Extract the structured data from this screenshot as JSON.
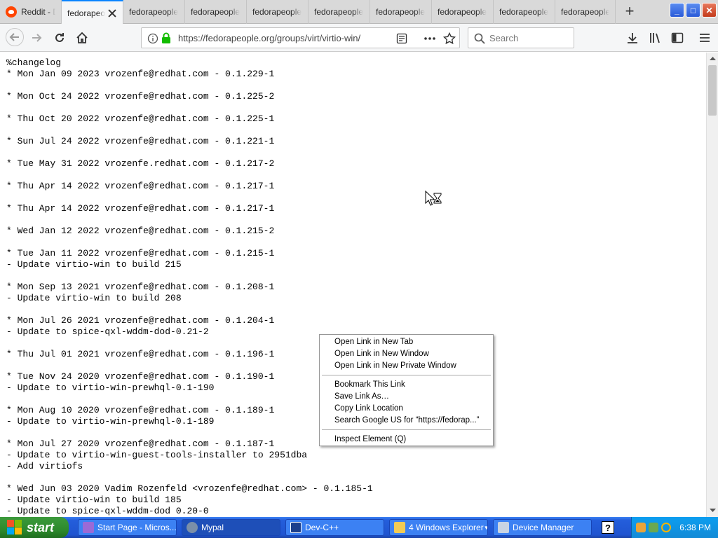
{
  "browser": {
    "tabs": [
      {
        "label": "Reddit - D",
        "active": false
      },
      {
        "label": "fedorapeo",
        "active": true
      },
      {
        "label": "fedorapeople",
        "active": false
      },
      {
        "label": "fedorapeople",
        "active": false
      },
      {
        "label": "fedorapeople",
        "active": false
      },
      {
        "label": "fedorapeople",
        "active": false
      },
      {
        "label": "fedorapeople",
        "active": false
      },
      {
        "label": "fedorapeople",
        "active": false
      },
      {
        "label": "fedorapeople",
        "active": false
      },
      {
        "label": "fedorapeople",
        "active": false
      }
    ],
    "new_tab_symbol": "+",
    "window_controls": {
      "minimize": "_",
      "maximize": "□",
      "close": "✕"
    },
    "url": "https://fedorapeople.org/groups/virt/virtio-win/",
    "search_placeholder": "Search",
    "icons": {
      "back": "arrow-left-icon",
      "forward": "arrow-right-icon",
      "reload": "reload-icon",
      "home": "home-icon",
      "info": "info-icon",
      "lock": "lock-icon",
      "reader": "reader-view-icon",
      "more": "more-icon",
      "bookmark": "star-icon",
      "search": "search-icon",
      "downloads": "download-icon",
      "library": "library-icon",
      "sidebar": "sidebar-icon",
      "menu": "hamburger-icon"
    },
    "accent_color": "#0a84ff",
    "lock_color": "#12bc00"
  },
  "changelog": [
    "%changelog",
    "* Mon Jan 09 2023 vrozenfe@redhat.com - 0.1.229-1",
    "",
    "* Mon Oct 24 2022 vrozenfe@redhat.com - 0.1.225-2",
    "",
    "* Thu Oct 20 2022 vrozenfe@redhat.com - 0.1.225-1",
    "",
    "* Sun Jul 24 2022 vrozenfe@redhat.com - 0.1.221-1",
    "",
    "* Tue May 31 2022 vrozenfe.redhat.com - 0.1.217-2",
    "",
    "* Thu Apr 14 2022 vrozenfe@redhat.com - 0.1.217-1",
    "",
    "* Thu Apr 14 2022 vrozenfe@redhat.com - 0.1.217-1",
    "",
    "* Wed Jan 12 2022 vrozenfe@redhat.com - 0.1.215-2",
    "",
    "* Tue Jan 11 2022 vrozenfe@redhat.com - 0.1.215-1",
    "- Update virtio-win to build 215",
    "",
    "* Mon Sep 13 2021 vrozenfe@redhat.com - 0.1.208-1",
    "- Update virtio-win to build 208",
    "",
    "* Mon Jul 26 2021 vrozenfe@redhat.com - 0.1.204-1",
    "- Update to spice-qxl-wddm-dod-0.21-2",
    "",
    "* Thu Jul 01 2021 vrozenfe@redhat.com - 0.1.196-1",
    "",
    "* Tue Nov 24 2020 vrozenfe@redhat.com - 0.1.190-1",
    "- Update to virtio-win-prewhql-0.1-190",
    "",
    "* Mon Aug 10 2020 vrozenfe@redhat.com - 0.1.189-1",
    "- Update to virtio-win-prewhql-0.1-189",
    "",
    "* Mon Jul 27 2020 vrozenfe@redhat.com - 0.1.187-1",
    "- Update to virtio-win-guest-tools-installer to 2951dba",
    "- Add virtiofs",
    "",
    "* Wed Jun 03 2020 Vadim Rozenfeld <vrozenfe@redhat.com> - 0.1.185-1",
    "- Update virtio-win to build 185",
    "- Update to spice-qxl-wddm-dod 0.20-0"
  ],
  "context_menu": {
    "group1": [
      "Open Link in New Tab",
      "Open Link in New Window",
      "Open Link in New Private Window"
    ],
    "group2": [
      "Bookmark This Link",
      "Save Link As…",
      "Copy Link Location",
      "Search Google US for “https://fedorap...”"
    ],
    "group3": [
      "Inspect Element (Q)"
    ]
  },
  "taskbar": {
    "start_label": "start",
    "buttons": [
      {
        "label": "Start Page - Micros...",
        "icon": "visual-studio-icon",
        "active": false
      },
      {
        "label": "Mypal",
        "icon": "mypal-browser-icon",
        "active": true
      },
      {
        "label": "Dev-C++",
        "icon": "devcpp-icon",
        "active": false
      },
      {
        "label": "4 Windows Explorer",
        "icon": "folder-icon",
        "active": false
      },
      {
        "label": "Device Manager",
        "icon": "device-manager-icon",
        "active": false
      }
    ],
    "help_label": "?",
    "clock": "6:38 PM"
  }
}
